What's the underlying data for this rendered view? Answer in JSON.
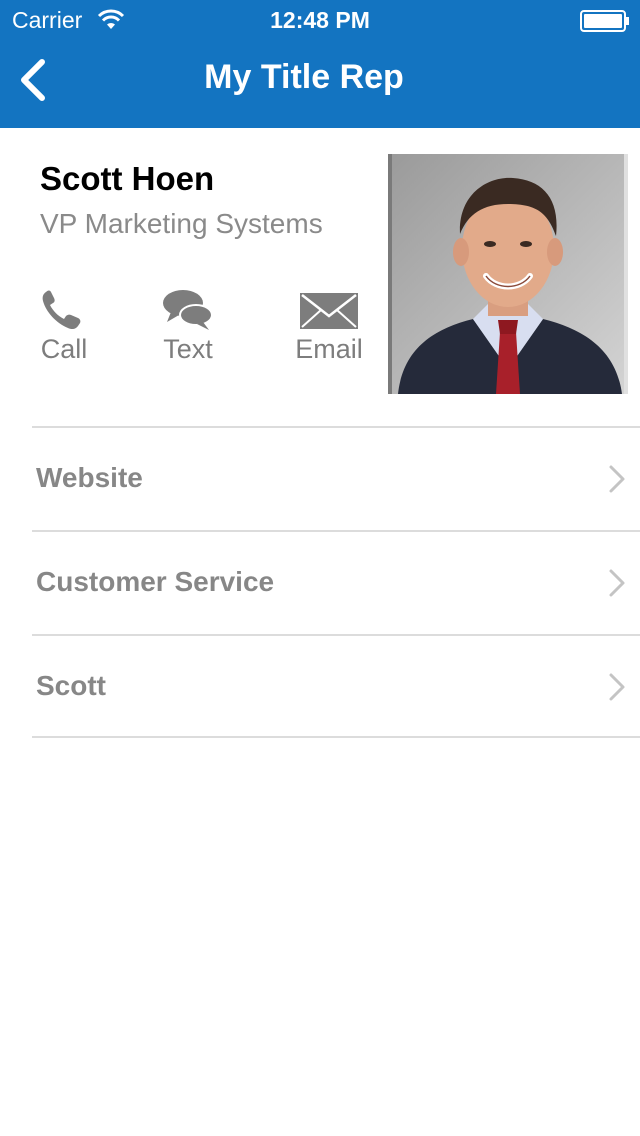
{
  "status_bar": {
    "carrier": "Carrier",
    "time": "12:48 PM"
  },
  "nav": {
    "title": "My Title Rep"
  },
  "profile": {
    "name": "Scott Hoen",
    "title": "VP Marketing Systems",
    "actions": [
      {
        "label": "Call",
        "icon": "phone-icon"
      },
      {
        "label": "Text",
        "icon": "chat-bubbles-icon"
      },
      {
        "label": "Email",
        "icon": "envelope-icon"
      }
    ]
  },
  "list": {
    "items": [
      {
        "label": "Website"
      },
      {
        "label": "Customer Service"
      },
      {
        "label": "Scott"
      }
    ]
  },
  "colors": {
    "header_blue": "#1374c1",
    "label_gray": "#878787",
    "divider": "#dcdcdc"
  }
}
